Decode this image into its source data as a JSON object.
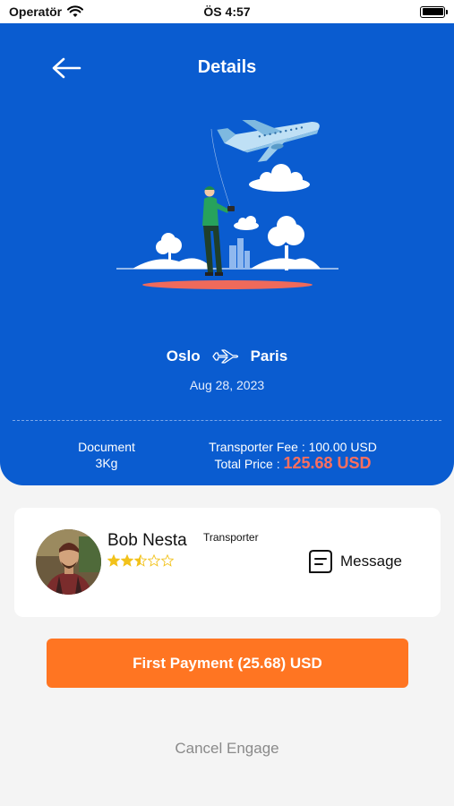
{
  "status_bar": {
    "carrier": "Operatör",
    "time": "ÖS 4:57"
  },
  "header": {
    "title": "Details",
    "back_icon": "arrow-left-icon"
  },
  "trip": {
    "origin": "Oslo",
    "destination": "Paris",
    "route_icon": "airplane-icon",
    "date": "Aug 28, 2023"
  },
  "package": {
    "type": "Document",
    "weight": "3Kg"
  },
  "pricing": {
    "fee_text": "Transporter Fee : 100.00 USD",
    "total_label": "Total Price :",
    "total_value": "125.68 USD"
  },
  "transporter": {
    "name": "Bob Nesta",
    "role": "Transporter",
    "rating": 2.5,
    "rating_max": 5,
    "message_label": "Message"
  },
  "actions": {
    "pay_label": "First Payment (25.68) USD",
    "cancel_label": "Cancel Engage"
  },
  "colors": {
    "primary": "#0a5cd0",
    "accent": "#ff7522",
    "price": "#ff6f5e",
    "star": "#f2c21b"
  }
}
